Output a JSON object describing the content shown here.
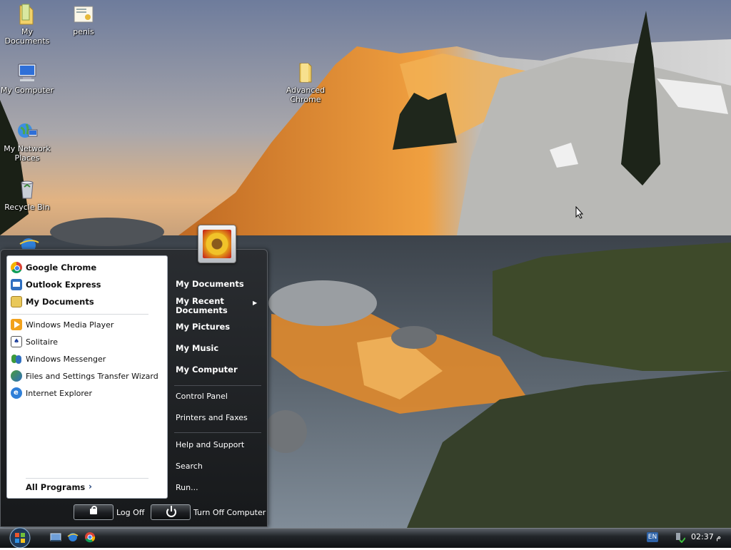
{
  "desktop": {
    "icons": [
      {
        "label": "My Documents",
        "icon": "folder-documents-icon"
      },
      {
        "label": "penis",
        "icon": "certificate-file-icon"
      },
      {
        "label": "My Computer",
        "icon": "computer-icon"
      },
      {
        "label": "My Network Places",
        "icon": "network-globe-icon"
      },
      {
        "label": "Recycle Bin",
        "icon": "recycle-bin-icon"
      },
      {
        "label": "Advanced Chrome",
        "icon": "folder-icon"
      }
    ]
  },
  "start_menu": {
    "pinned": [
      {
        "label": "Google Chrome",
        "icon": "chrome-icon"
      },
      {
        "label": "Outlook Express",
        "icon": "outlook-express-icon"
      },
      {
        "label": "My Documents",
        "icon": "folder-documents-icon"
      }
    ],
    "recent": [
      {
        "label": "Windows Media Player",
        "icon": "media-player-icon"
      },
      {
        "label": "Solitaire",
        "icon": "solitaire-icon"
      },
      {
        "label": "Windows Messenger",
        "icon": "messenger-icon"
      },
      {
        "label": "Files and Settings Transfer Wizard",
        "icon": "transfer-wizard-icon"
      },
      {
        "label": "Internet Explorer",
        "icon": "internet-explorer-icon"
      }
    ],
    "all_programs": "All Programs",
    "places": [
      "My Documents",
      "My Recent Documents",
      "My Pictures",
      "My Music",
      "My Computer"
    ],
    "system": [
      "Control Panel",
      "Printers and Faxes"
    ],
    "help": [
      "Help and Support",
      "Search",
      "Run..."
    ],
    "log_off": "Log Off",
    "turn_off": "Turn Off Computer"
  },
  "taskbar": {
    "quick_launch": [
      "show-desktop-icon",
      "internet-explorer-icon",
      "chrome-icon"
    ],
    "language": "EN",
    "clock": "02:37 م"
  },
  "colors": {
    "menu_dark": "#1c1e21",
    "taskbar": "#22262a",
    "accent_orange": "#e39a18"
  }
}
